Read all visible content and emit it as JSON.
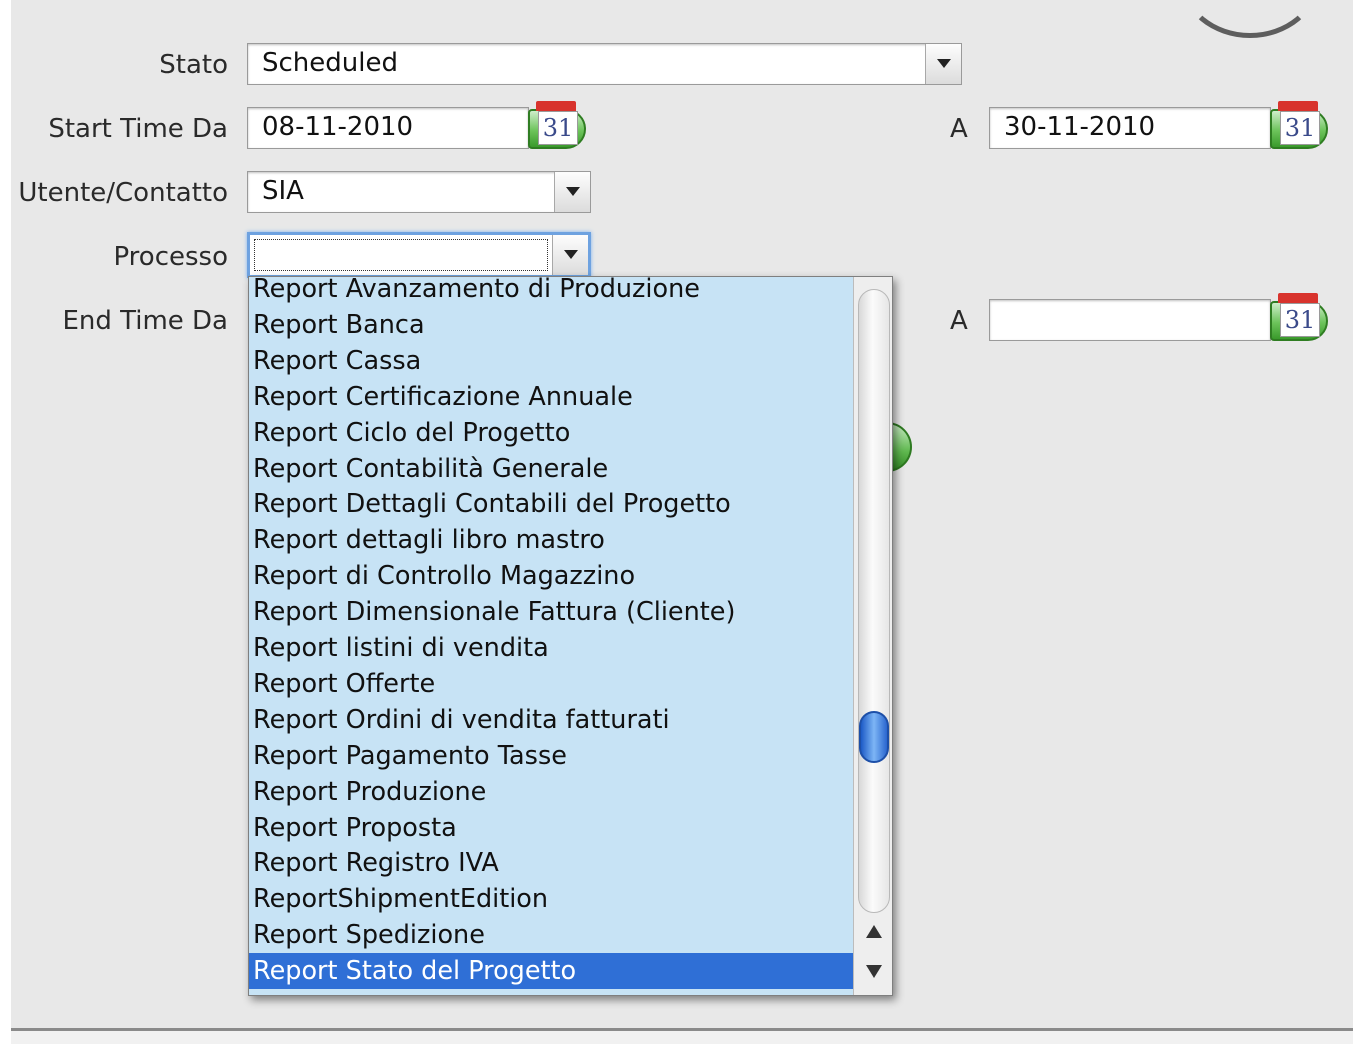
{
  "labels": {
    "stato": "Stato",
    "start_time_da": "Start Time Da",
    "utente_contatto": "Utente/Contatto",
    "processo": "Processo",
    "end_time_da": "End Time Da",
    "a": "A"
  },
  "fields": {
    "stato": "Scheduled",
    "start_time_from": "08-11-2010",
    "start_time_to": "30-11-2010",
    "utente": "SIA",
    "processo": "",
    "end_time_from": "",
    "end_time_to": ""
  },
  "calendar_label": "31",
  "processo_options": [
    "Report Avanzamento di Produzione",
    "Report Banca",
    "Report Cassa",
    "Report Certificazione Annuale",
    "Report Ciclo del Progetto",
    "Report Contabilità Generale",
    "Report Dettagli Contabili del Progetto",
    "Report dettagli libro mastro",
    "Report di Controllo Magazzino",
    "Report Dimensionale Fattura (Cliente)",
    "Report listini di vendita",
    "Report Offerte",
    "Report Ordini di vendita fatturati",
    "Report Pagamento Tasse",
    "Report Produzione",
    "Report Proposta",
    "Report Registro IVA",
    "ReportShipmentEdition",
    "Report Spedizione",
    "Report Stato del Progetto"
  ],
  "selected_option": "Report Stato del Progetto",
  "colors": {
    "list_background": "#c7e3f5",
    "selection": "#2f6fd6",
    "calendar_green": "#6cc35a",
    "calendar_red": "#d8332d"
  },
  "icons": [
    "calendar-icon",
    "dropdown-arrow-icon",
    "scroll-up-icon",
    "scroll-down-icon"
  ]
}
